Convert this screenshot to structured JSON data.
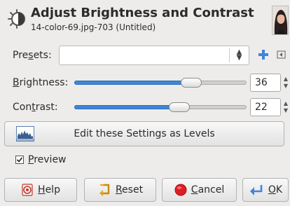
{
  "dialog": {
    "title": "Adjust Brightness and Contrast",
    "subtitle": "14-color-69.jpg-703 (Untitled)"
  },
  "presets": {
    "label_pre": "Pre",
    "label_u": "s",
    "label_post": "ets:",
    "value": ""
  },
  "brightness": {
    "label_u": "B",
    "label_post": "rightness:",
    "value": "36",
    "level": 0.68
  },
  "contrast": {
    "label_pre": "Con",
    "label_u": "t",
    "label_post": "rast:",
    "value": "22",
    "level": 0.61
  },
  "levels_button": {
    "label": "Edit these Settings as Levels"
  },
  "preview": {
    "label_u": "P",
    "label_post": "review",
    "checked": true
  },
  "buttons": {
    "help": {
      "u": "H",
      "rest": "elp"
    },
    "reset": {
      "u": "R",
      "rest": "eset"
    },
    "cancel": {
      "u": "C",
      "rest": "ancel"
    },
    "ok": {
      "u": "O",
      "rest": "K"
    }
  },
  "icons": {
    "header": "brightness-contrast-icon",
    "plus": "add-preset-icon",
    "menu": "preset-menu-icon",
    "levels": "levels-histogram-icon",
    "help": "help-icon",
    "reset": "reset-icon",
    "cancel": "cancel-icon",
    "ok": "ok-icon"
  },
  "colors": {
    "slider_fill": "#3f86d8",
    "cancel_red": "#e01b24",
    "add_blue": "#3f86d8"
  }
}
